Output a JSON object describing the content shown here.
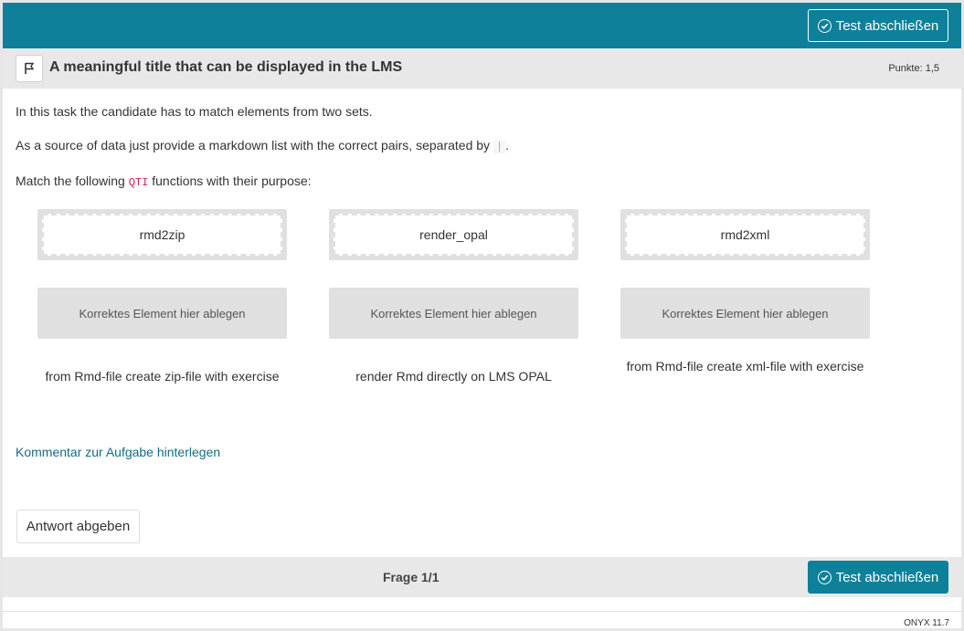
{
  "header": {
    "finish_button_label": "Test abschließen"
  },
  "task": {
    "title": "A meaningful title that can be displayed in the LMS",
    "points": "Punkte: 1,5",
    "intro_1": "In this task the candidate has to match elements from two sets.",
    "intro_2_before": "As a source of data just provide a markdown list with the correct pairs, separated by ",
    "intro_2_code": "|",
    "intro_2_after": ".",
    "intro_3_before": "Match the following ",
    "intro_3_code": "QTI",
    "intro_3_after": " functions with their purpose:"
  },
  "match": {
    "sources": [
      "rmd2zip",
      "render_opal",
      "rmd2xml"
    ],
    "target_placeholder": "Korrektes Element hier ablegen",
    "descriptions": [
      "from Rmd-file create zip-file with exercise",
      "render Rmd directly on LMS OPAL",
      "from Rmd-file create xml-file with exercise"
    ]
  },
  "comment_link": "Kommentar zur Aufgabe hinterlegen",
  "submit_label": "Antwort abgeben",
  "footer": {
    "question_label": "Frage 1/1",
    "finish_button_label": "Test abschließen",
    "version": "ONYX 11.7"
  },
  "colors": {
    "accent": "#0e8099",
    "link": "#0e6f85",
    "bar_gray": "#e8e8e8"
  }
}
